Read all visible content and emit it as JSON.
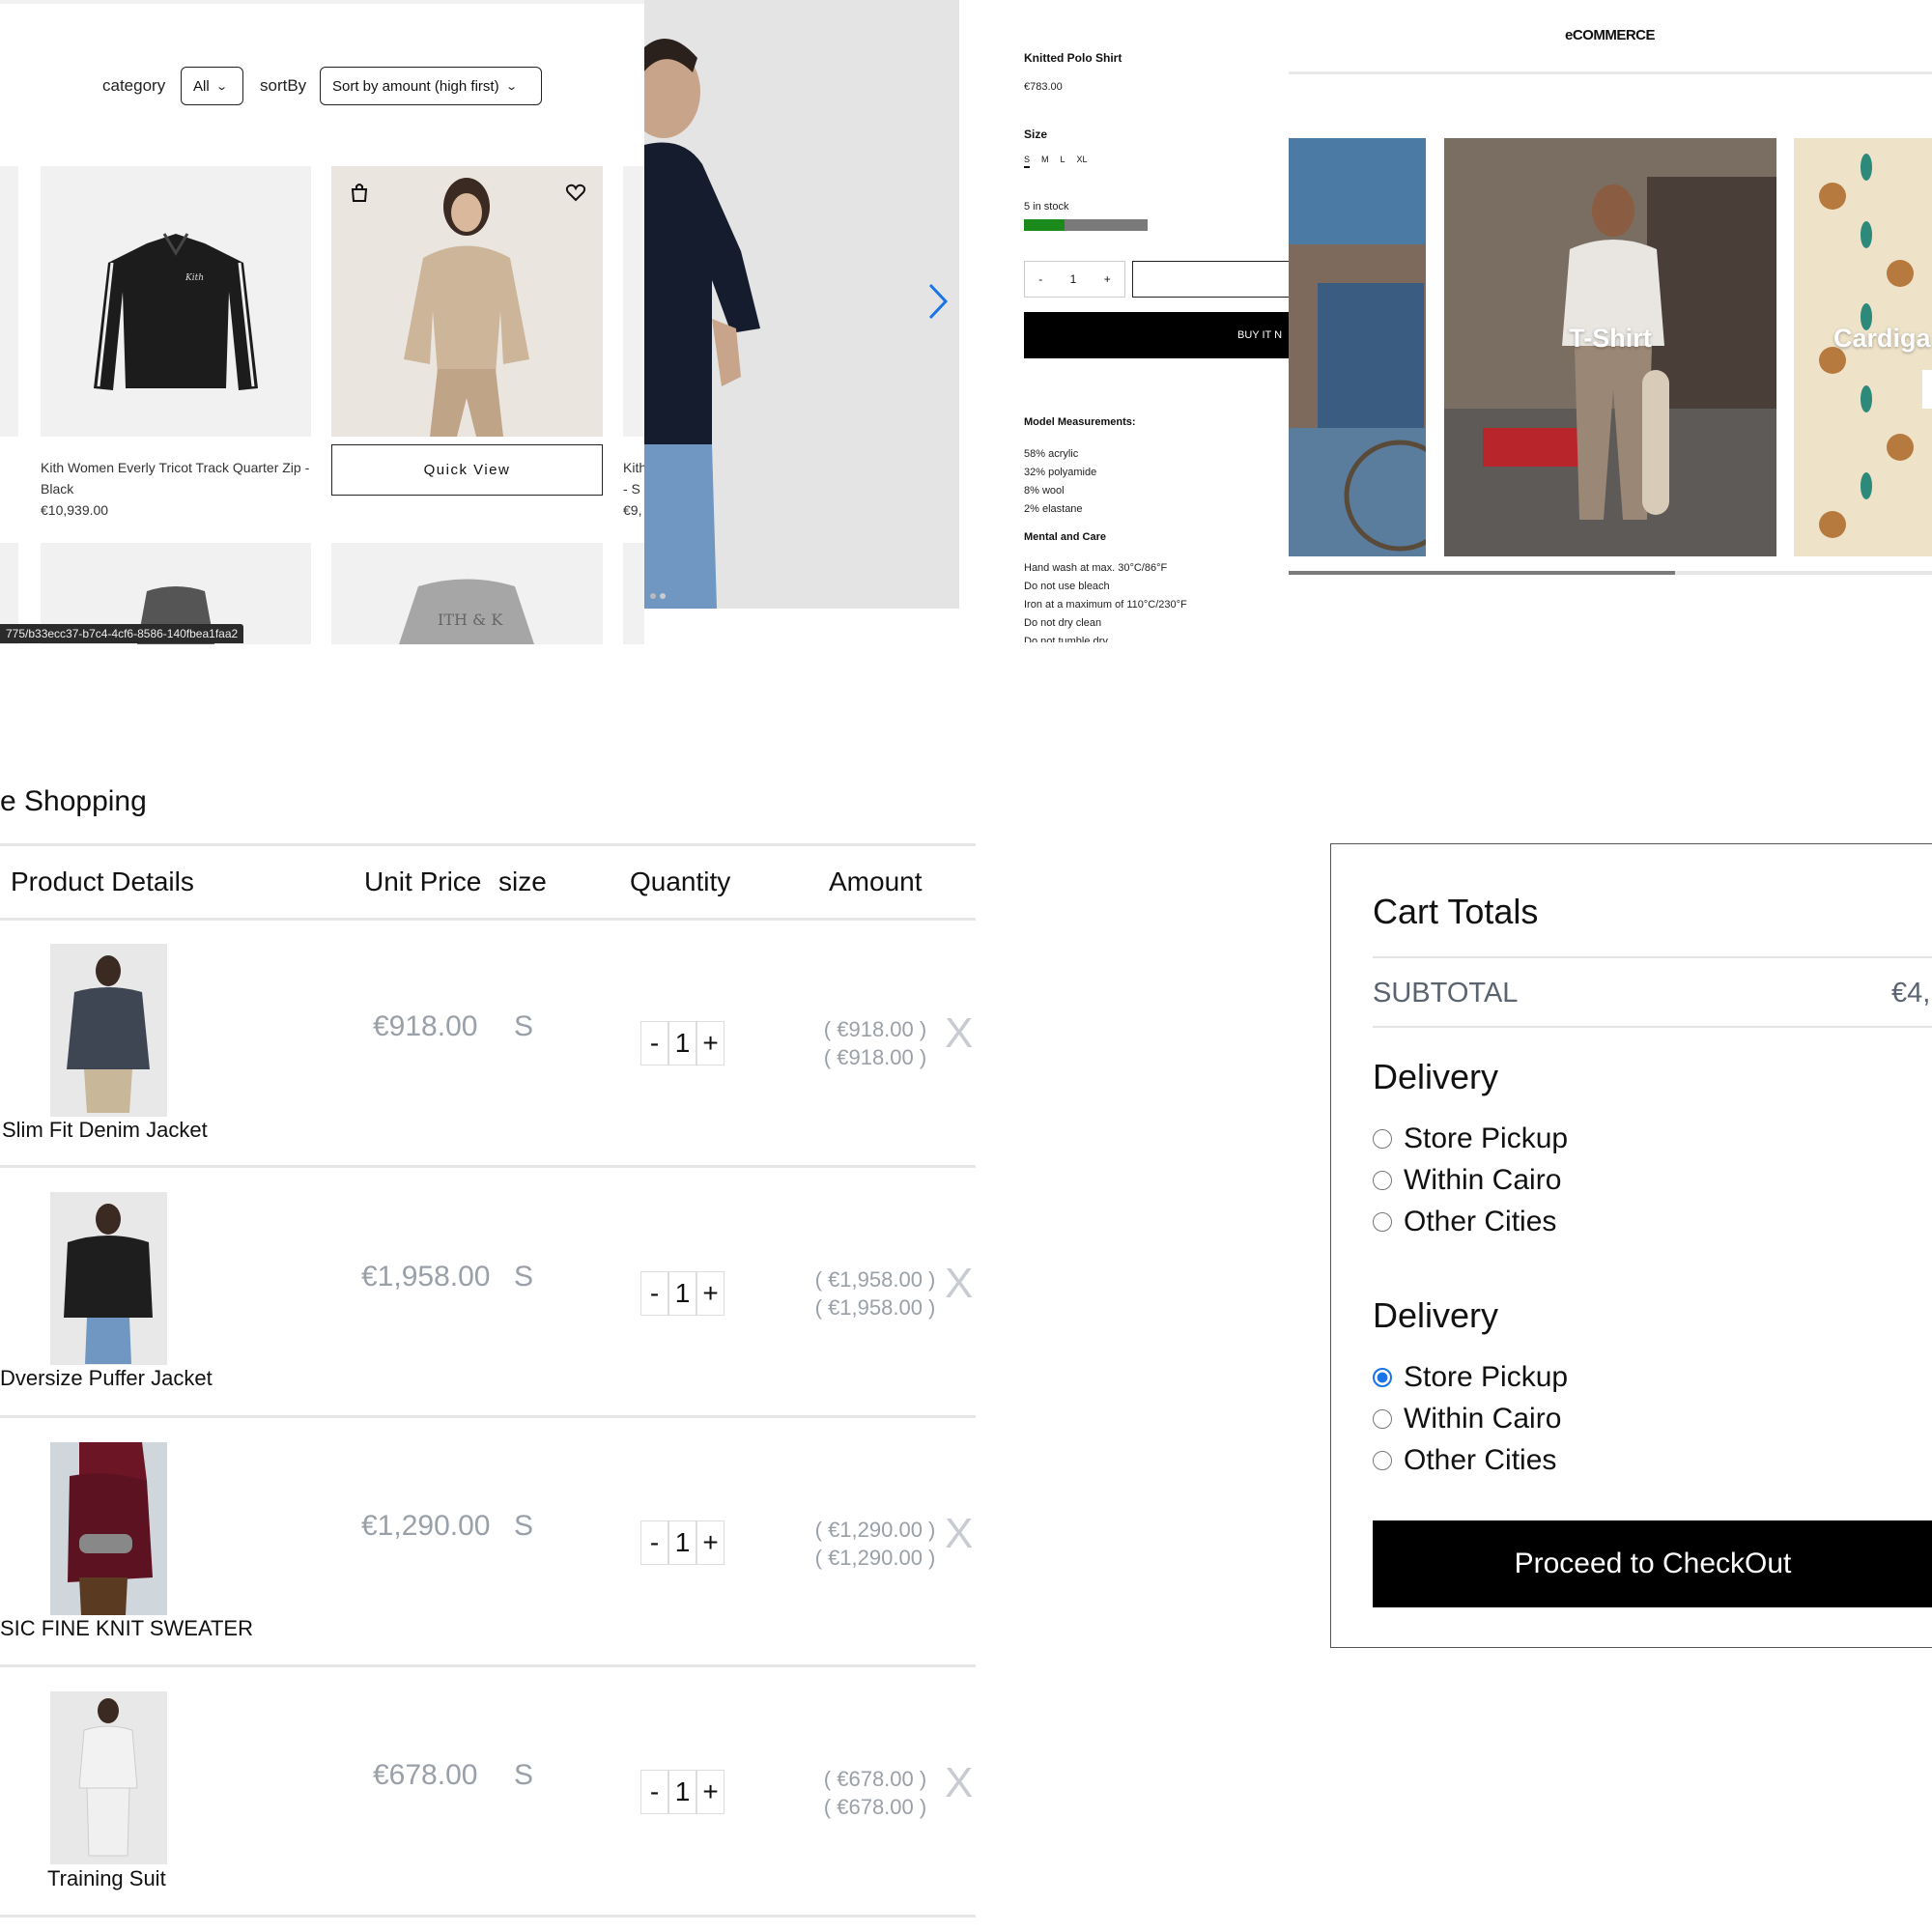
{
  "listing": {
    "category_label": "category",
    "category_value": "All",
    "sortby_label": "sortBy",
    "sortby_value": "Sort by amount (high first)",
    "product1": {
      "title": "Kith Women Everly Tricot Track Quarter Zip - Black",
      "price": "€10,939.00"
    },
    "product2": {
      "quick_view": "Quick View"
    },
    "product3": {
      "title_partial": "Kith",
      "title_partial2": "- S",
      "price_partial": "€9,"
    },
    "url_tooltip": "775/b33ecc37-b7c4-4cf6-8586-140fbea1faa2",
    "icons": [
      "bag-icon",
      "heart-icon",
      "chevron-right-icon"
    ]
  },
  "product_detail": {
    "name": "Knitted Polo Shirt",
    "price": "€783.00",
    "size_label": "Size",
    "sizes": [
      "S",
      "M",
      "L",
      "XL"
    ],
    "selected_size": "S",
    "stock_text": "5 in stock",
    "stock_fraction": 0.33,
    "stock_color": "#1a8a1a",
    "quantity": "1",
    "minus": "-",
    "plus": "+",
    "buy_label": "BUY IT N",
    "measurements_title": "Model Measurements:",
    "materials": [
      "58% acrylic",
      "32% polyamide",
      "8% wool",
      "2% elastane"
    ],
    "care_title": "Mental and Care",
    "care": [
      "Hand wash at max. 30°C/86°F",
      "Do not use bleach",
      "Iron at a maximum of 110°C/230°F",
      "Do not dry clean",
      "Do not tumble dry"
    ]
  },
  "carousel": {
    "brand": "eCOMMERCE",
    "categories": [
      "T-Shirt",
      "Cardiga"
    ],
    "scroll_fraction": 0.6
  },
  "cart": {
    "title": "e Shopping",
    "headers": {
      "details": "Product Details",
      "unit_price": "Unit Price",
      "size": "size",
      "quantity": "Quantity",
      "amount": "Amount"
    },
    "rows": [
      {
        "name": "Slim Fit Denim Jacket",
        "price": "€918.00",
        "size": "S",
        "qty": "1",
        "amount1": "( €918.00 )",
        "amount2": "( €918.00 )"
      },
      {
        "name": "Dversize Puffer Jacket",
        "price": "€1,958.00",
        "size": "S",
        "qty": "1",
        "amount1": "( €1,958.00 )",
        "amount2": "( €1,958.00 )"
      },
      {
        "name": "SIC FINE KNIT SWEATER",
        "price": "€1,290.00",
        "size": "S",
        "qty": "1",
        "amount1": "( €1,290.00 )",
        "amount2": "( €1,290.00 )"
      },
      {
        "name": "Training Suit",
        "price": "€678.00",
        "size": "S",
        "qty": "1",
        "amount1": "( €678.00 )",
        "amount2": "( €678.00 )"
      }
    ],
    "minus": "-",
    "plus": "+",
    "remove": "X"
  },
  "totals": {
    "title": "Cart Totals",
    "subtotal_label": "SUBTOTAL",
    "subtotal_value": "€4,",
    "delivery_title": "Delivery",
    "options": [
      "Store Pickup",
      "Within Cairo",
      "Other Cities"
    ],
    "selected_second_group": "Store Pickup",
    "checkout": "Proceed to CheckOut"
  }
}
